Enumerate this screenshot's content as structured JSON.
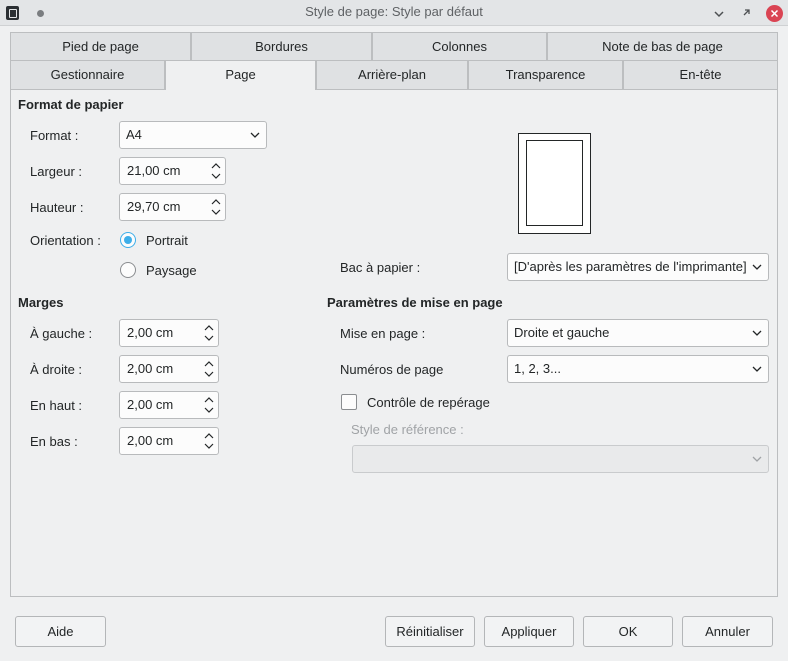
{
  "window": {
    "title": "Style de page: Style par défaut"
  },
  "tabs": {
    "row1": [
      "Pied de page",
      "Bordures",
      "Colonnes",
      "Note de bas de page"
    ],
    "row2": [
      "Gestionnaire",
      "Page",
      "Arrière-plan",
      "Transparence",
      "En-tête"
    ],
    "active": "Page"
  },
  "paper_format": {
    "title": "Format de papier",
    "format_label": "Format :",
    "format_value": "A4",
    "width_label": "Largeur :",
    "width_value": "21,00 cm",
    "height_label": "Hauteur :",
    "height_value": "29,70 cm",
    "orientation_label": "Orientation :",
    "portrait_label": "Portrait",
    "landscape_label": "Paysage",
    "orientation_selected": "Portrait",
    "tray_label": "Bac à papier :",
    "tray_value": "[D'après les paramètres de l'imprimante]"
  },
  "margins": {
    "title": "Marges",
    "left_label": "À gauche :",
    "left_value": "2,00 cm",
    "right_label": "À droite :",
    "right_value": "2,00 cm",
    "top_label": "En haut :",
    "top_value": "2,00 cm",
    "bottom_label": "En bas :",
    "bottom_value": "2,00 cm"
  },
  "layout": {
    "title": "Paramètres de mise en page",
    "layout_label": "Mise en page :",
    "layout_value": "Droite et gauche",
    "numbers_label": "Numéros de page",
    "numbers_value": "1, 2, 3...",
    "register_label": "Contrôle de repérage",
    "register_checked": false,
    "ref_style_label": "Style de référence :",
    "ref_style_value": ""
  },
  "buttons": {
    "help": "Aide",
    "reset": "Réinitialiser",
    "apply": "Appliquer",
    "ok": "OK",
    "cancel": "Annuler"
  },
  "colors": {
    "accent": "#3daee9",
    "close": "#da4453"
  }
}
